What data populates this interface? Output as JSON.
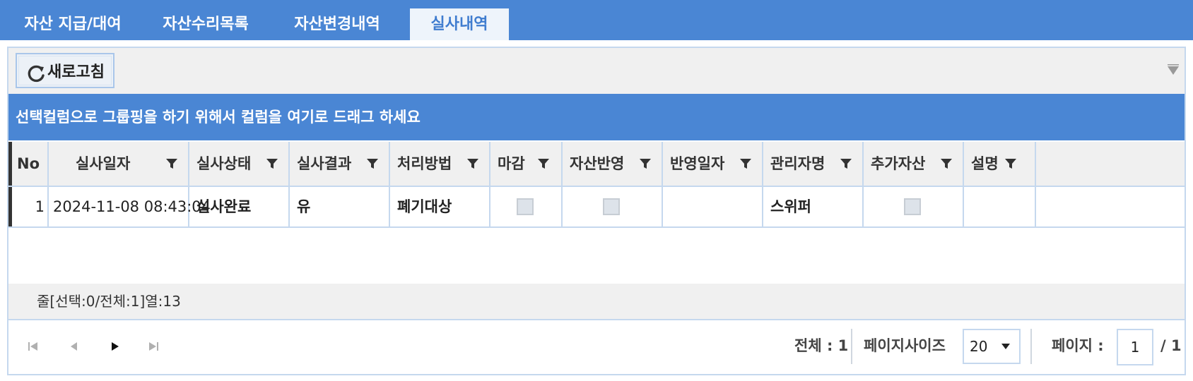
{
  "tabs": [
    {
      "label": "자산 지급/대여",
      "active": false
    },
    {
      "label": "자산수리목록",
      "active": false
    },
    {
      "label": "자산변경내역",
      "active": false
    },
    {
      "label": "실사내역",
      "active": true
    }
  ],
  "toolbar": {
    "refresh_label": "새로고침",
    "refresh_icon": "refresh-icon",
    "menu_icon": "filter-menu-icon"
  },
  "group_band_text": "선택컬럼으로 그룹핑을 하기 위해서 컬럼을 여기로 드래그 하세요",
  "columns": [
    "No",
    "실사일자",
    "실사상태",
    "실사결과",
    "처리방법",
    "마감",
    "자산반영",
    "반영일자",
    "관리자명",
    "추가자산",
    "설명"
  ],
  "rows": [
    {
      "no": "1",
      "date": "2024-11-08 08:43:04",
      "status": "실사완료",
      "result": "유",
      "method": "폐기대상",
      "closed": false,
      "applied": false,
      "applied_date": "",
      "manager": "스위퍼",
      "extra_asset": false,
      "description": ""
    }
  ],
  "summary": "줄[선택:0/전체:1]열:13",
  "pager": {
    "total_label": "전체 : 1",
    "page_size_label": "페이지사이즈",
    "page_size_value": "20",
    "page_label": "페이지 :",
    "current_page": "1",
    "total_pages": "/ 1"
  },
  "colors": {
    "accent": "#4a86d4",
    "border": "#c5d8ee",
    "header_bg": "#f0f0f0"
  }
}
